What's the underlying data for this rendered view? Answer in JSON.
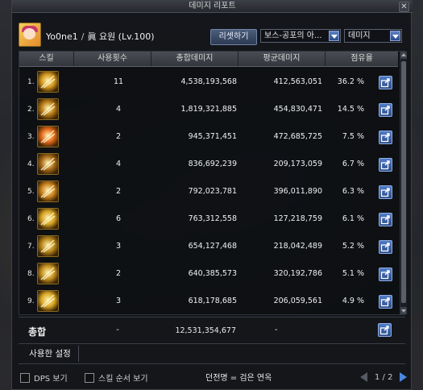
{
  "window": {
    "title": "데미지 리포트",
    "close_icon": "close-icon"
  },
  "player": {
    "name": "Yo0ne1",
    "separator": "/",
    "job": "眞 요원 (Lv.100)"
  },
  "controls": {
    "reset_label": "리셋하기",
    "dungeon_select": "보스-공포의 아...",
    "mode_select": "데미지"
  },
  "table": {
    "headers": [
      "스킬",
      "사용횟수",
      "총합데미지",
      "평균데미지",
      "점유율"
    ],
    "rows": [
      {
        "rank": "1.",
        "count": "11",
        "total": "4,538,193,568",
        "avg": "412,563,051",
        "pct": "36.2 %",
        "icon": "skill-dagger-icon",
        "color": "#d2961e"
      },
      {
        "rank": "2.",
        "count": "4",
        "total": "1,819,321,885",
        "avg": "454,830,471",
        "pct": "14.5 %",
        "icon": "skill-seal-icon",
        "color": "#b87a16"
      },
      {
        "rank": "3.",
        "count": "2",
        "total": "945,371,451",
        "avg": "472,685,725",
        "pct": "7.5 %",
        "icon": "skill-fire-burst-icon",
        "color": "#e0661a"
      },
      {
        "rank": "4.",
        "count": "4",
        "total": "836,692,239",
        "avg": "209,173,059",
        "pct": "6.7 %",
        "icon": "skill-crosshair-icon",
        "color": "#a86a18"
      },
      {
        "rank": "5.",
        "count": "2",
        "total": "792,023,781",
        "avg": "396,011,890",
        "pct": "6.3 %",
        "icon": "skill-agent-strike-icon",
        "color": "#c9801c"
      },
      {
        "rank": "6.",
        "count": "6",
        "total": "763,312,558",
        "avg": "127,218,759",
        "pct": "6.1 %",
        "icon": "skill-target-icon",
        "color": "#d4a020"
      },
      {
        "rank": "7.",
        "count": "3",
        "total": "654,127,468",
        "avg": "218,042,489",
        "pct": "5.2 %",
        "icon": "skill-arc-slash-icon",
        "color": "#b8861a"
      },
      {
        "rank": "8.",
        "count": "2",
        "total": "640,385,573",
        "avg": "320,192,786",
        "pct": "5.1 %",
        "icon": "skill-blade-icon",
        "color": "#c48f1e"
      },
      {
        "rank": "9.",
        "count": "3",
        "total": "618,178,685",
        "avg": "206,059,561",
        "pct": "4.9 %",
        "icon": "skill-rush-icon",
        "color": "#d9a624"
      }
    ]
  },
  "total": {
    "label": "총합",
    "count": "-",
    "sum": "12,531,354,677",
    "avg": "-"
  },
  "tabs": {
    "used_settings": "사용한 설정"
  },
  "footer": {
    "dps_view": "DPS 보기",
    "skill_order_view": "스킬 순서 보기",
    "notice": "던전명 = 검은 연옥",
    "page": "1 / 2"
  },
  "colors": {
    "accent": "#3c6fc4",
    "header_bg": "#3f4248"
  }
}
